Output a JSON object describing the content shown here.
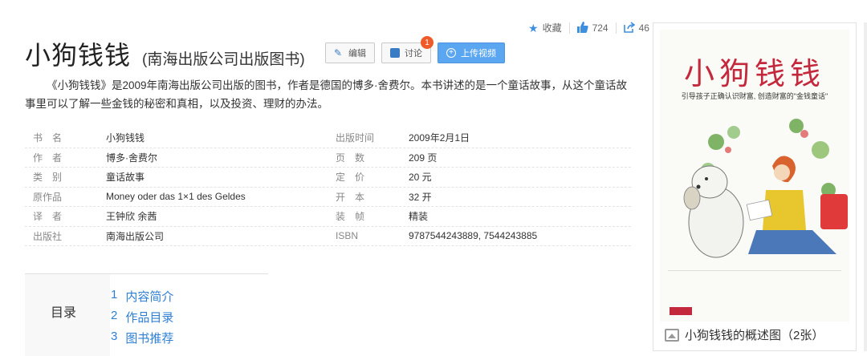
{
  "actions": {
    "collect_label": "收藏",
    "like_count": "724",
    "share_count": "46"
  },
  "header": {
    "title": "小狗钱钱",
    "subtitle": "(南海出版公司出版图书)"
  },
  "buttons": {
    "edit": "编辑",
    "discuss": "讨论",
    "discuss_badge": "1",
    "upload": "上传视频"
  },
  "summary": "《小狗钱钱》是2009年南海出版公司出版的图书，作者是德国的博多·舍费尔。本书讲述的是一个童话故事，从这个童话故事里可以了解一些金钱的秘密和真相，以及投资、理财的办法。",
  "info": [
    {
      "k": "书　名",
      "v": "小狗钱钱",
      "k2": "出版时间",
      "v2": "2009年2月1日"
    },
    {
      "k": "作　者",
      "v": "博多·舍费尔",
      "k2": "页　数",
      "v2": "209 页"
    },
    {
      "k": "类　别",
      "v": "童话故事",
      "k2": "定　价",
      "v2": "20 元"
    },
    {
      "k": "原作品",
      "v": "Money oder das 1×1 des Geldes",
      "k2": "开　本",
      "v2": "32 开"
    },
    {
      "k": "译　者",
      "v": "王钟欣 余茜",
      "k2": "装　帧",
      "v2": "精装"
    },
    {
      "k": "出版社",
      "v": "南海出版公司",
      "k2": "ISBN",
      "v2": "9787544243889, 7544243885"
    }
  ],
  "toc": {
    "title": "目录",
    "items": [
      {
        "num": "1",
        "label": "内容简介"
      },
      {
        "num": "2",
        "label": "作品目录"
      },
      {
        "num": "3",
        "label": "图书推荐"
      }
    ]
  },
  "cover": {
    "title": "小狗钱钱",
    "tagline": "引导孩子正确认识财富, 创造财富的\"金钱童话\"",
    "caption": "小狗钱钱的概述图（2张）"
  },
  "colors": {
    "link": "#2e7fd4",
    "primary_button": "#5aa6f0",
    "badge": "#f05a28",
    "cover_title": "#c4283c"
  }
}
